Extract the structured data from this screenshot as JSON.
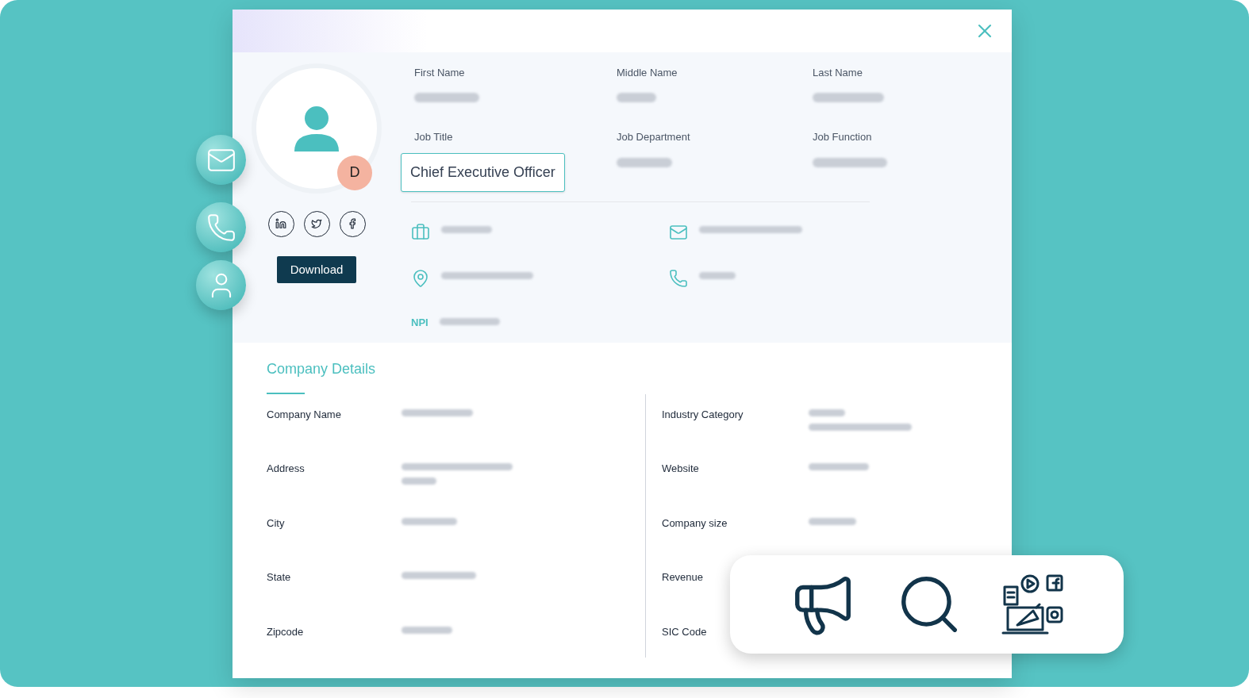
{
  "side_actions": [
    {
      "kind": "mail"
    },
    {
      "kind": "phone"
    },
    {
      "kind": "user"
    }
  ],
  "profile": {
    "initial": "D",
    "socials": [
      {
        "kind": "linkedin"
      },
      {
        "kind": "twitter"
      },
      {
        "kind": "facebook"
      }
    ],
    "download": "Download"
  },
  "fields": [
    {
      "label": "First Name",
      "blurred": true,
      "selected": false
    },
    {
      "label": "Middle Name",
      "blurred": true,
      "selected": false
    },
    {
      "label": "Last Name",
      "blurred": true,
      "selected": false
    },
    {
      "label": "Job Title",
      "value": "Chief Executive Officer",
      "blurred": false,
      "selected": true
    },
    {
      "label": "Job Department",
      "blurred": true,
      "selected": false
    },
    {
      "label": "Job Function",
      "blurred": true,
      "selected": false
    }
  ],
  "contacts": [
    {
      "kind": "briefcase",
      "blurred": true
    },
    {
      "kind": "mail",
      "blurred": true
    },
    {
      "kind": "location",
      "blurred": true
    },
    {
      "kind": "phone",
      "blurred": true
    },
    {
      "kind": "npi",
      "label": "NPI",
      "blurred": true
    }
  ],
  "company": {
    "title": "Company Details",
    "left": [
      {
        "label": "Company Name",
        "blurred": true
      },
      {
        "label": "Address",
        "blurred": true
      },
      {
        "label": "City",
        "blurred": true
      },
      {
        "label": "State",
        "blurred": true
      },
      {
        "label": "Zipcode",
        "blurred": true
      }
    ],
    "right": [
      {
        "label": "Industry Category",
        "blurred": true
      },
      {
        "label": "Website",
        "blurred": true
      },
      {
        "label": "Company size",
        "blurred": true
      },
      {
        "label": "Revenue"
      },
      {
        "label": "SIC Code"
      }
    ]
  },
  "features": [
    {
      "kind": "megaphone"
    },
    {
      "kind": "search"
    },
    {
      "kind": "social-media"
    }
  ]
}
